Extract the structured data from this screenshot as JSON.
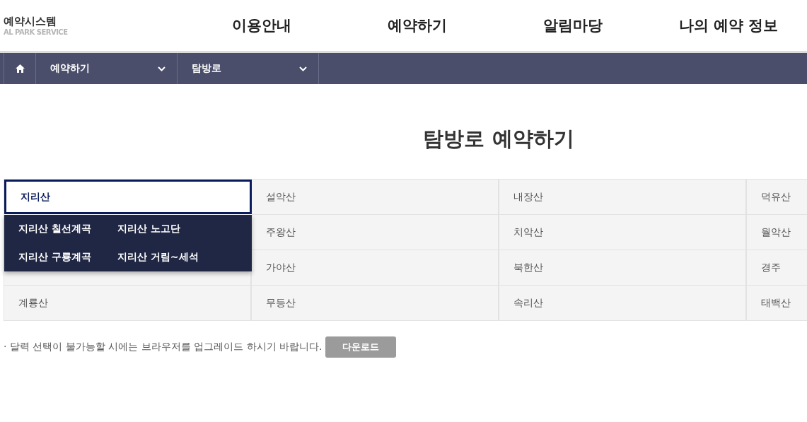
{
  "logo": {
    "title": "예약시스템",
    "subtitle": "AL PARK SERVICE"
  },
  "nav": [
    "이용안내",
    "예약하기",
    "알림마당",
    "나의 예약 정보"
  ],
  "breadcrumb": [
    "예약하기",
    "탐방로"
  ],
  "heading": "탐방로 예약하기",
  "mountains": [
    {
      "label": "지리산",
      "selected": true,
      "expanded": true,
      "children": [
        {
          "label": "지리산 칠선계곡"
        },
        {
          "label": "지리산 노고단"
        },
        {
          "label": "지리산 구룡계곡"
        },
        {
          "label": "지리산 거림~세석"
        }
      ]
    },
    {
      "label": "설악산",
      "selected": false
    },
    {
      "label": "내장산",
      "selected": false
    },
    {
      "label": "덕유산",
      "selected": false
    },
    {
      "label": "주왕산",
      "selected": false
    },
    {
      "label": "치악산",
      "selected": false
    },
    {
      "label": "월악산",
      "selected": false
    },
    {
      "selected": false
    },
    {
      "label": "가야산",
      "selected": false
    },
    {
      "label": "북한산",
      "selected": false
    },
    {
      "label": "경주",
      "selected": false
    },
    {
      "label": "계룡산",
      "selected": false
    },
    {
      "label": "무등산",
      "selected": false
    },
    {
      "label": "속리산",
      "selected": false
    },
    {
      "label": "태백산",
      "selected": false
    }
  ],
  "notice": "· 달력 선택이 불가능할 시에는 브라우저를 업그레이드 하시기 바랍니다.",
  "download_button": "다운로드"
}
